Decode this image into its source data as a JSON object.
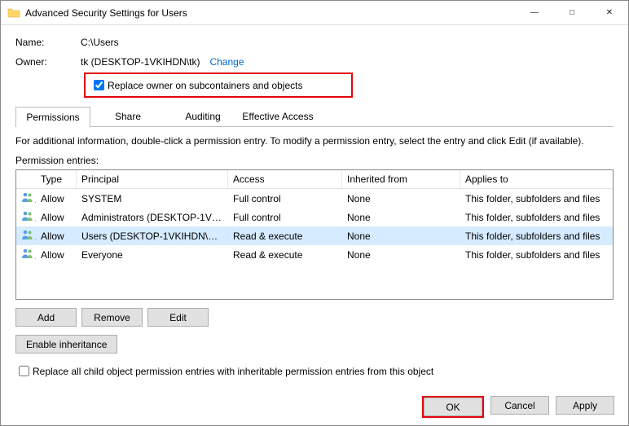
{
  "window": {
    "title": "Advanced Security Settings for Users"
  },
  "labels": {
    "name": "Name:",
    "owner": "Owner:",
    "change": "Change",
    "replaceOwner": "Replace owner on subcontainers and objects",
    "info": "For additional information, double-click a permission entry. To modify a permission entry, select the entry and click Edit (if available).",
    "permEntries": "Permission entries:",
    "replaceChild": "Replace all child object permission entries with inheritable permission entries from this object"
  },
  "values": {
    "name": "C:\\Users",
    "owner": "tk (DESKTOP-1VKIHDN\\tk)"
  },
  "tabs": [
    "Permissions",
    "Share",
    "Auditing",
    "Effective Access"
  ],
  "columns": {
    "type": "Type",
    "principal": "Principal",
    "access": "Access",
    "inherited": "Inherited from",
    "applies": "Applies to"
  },
  "rows": [
    {
      "type": "Allow",
      "principal": "SYSTEM",
      "access": "Full control",
      "inherited": "None",
      "applies": "This folder, subfolders and files",
      "selected": false
    },
    {
      "type": "Allow",
      "principal": "Administrators (DESKTOP-1VK...",
      "access": "Full control",
      "inherited": "None",
      "applies": "This folder, subfolders and files",
      "selected": false
    },
    {
      "type": "Allow",
      "principal": "Users (DESKTOP-1VKIHDN\\Us...",
      "access": "Read & execute",
      "inherited": "None",
      "applies": "This folder, subfolders and files",
      "selected": true
    },
    {
      "type": "Allow",
      "principal": "Everyone",
      "access": "Read & execute",
      "inherited": "None",
      "applies": "This folder, subfolders and files",
      "selected": false
    }
  ],
  "buttons": {
    "add": "Add",
    "remove": "Remove",
    "edit": "Edit",
    "enableInherit": "Enable inheritance",
    "ok": "OK",
    "cancel": "Cancel",
    "apply": "Apply"
  }
}
